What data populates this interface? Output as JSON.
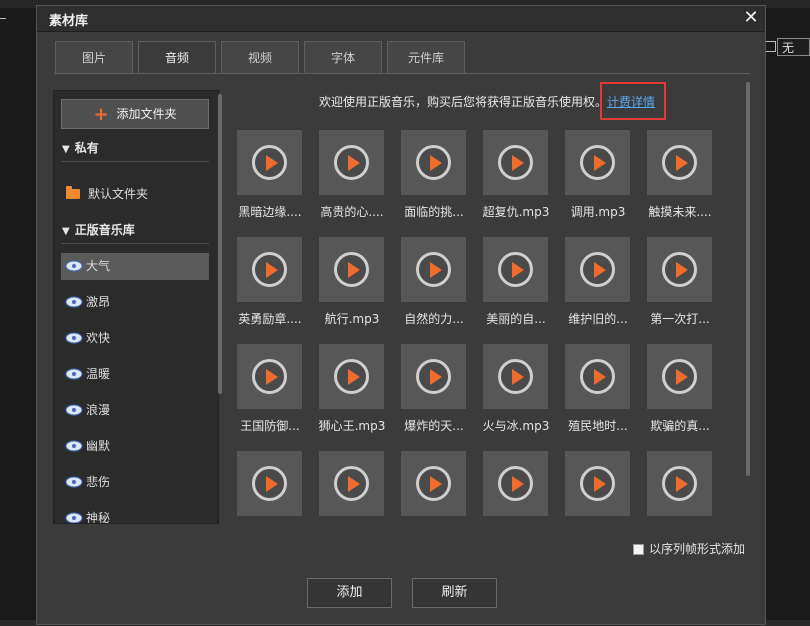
{
  "background": {
    "select_value": "无"
  },
  "dialog": {
    "title": "素材库",
    "close_glyph": "✕",
    "tabs": [
      {
        "label": "图片",
        "active": false
      },
      {
        "label": "音频",
        "active": true
      },
      {
        "label": "视频",
        "active": false
      },
      {
        "label": "字体",
        "active": false
      },
      {
        "label": "元件库",
        "active": false
      }
    ]
  },
  "sidebar": {
    "add_folder_label": "添加文件夹",
    "add_folder_icon": "plus-icon",
    "private_group": "私有",
    "default_folder": "默认文件夹",
    "library_group": "正版音乐库",
    "items": [
      {
        "label": "大气",
        "active": true
      },
      {
        "label": "激昂",
        "active": false
      },
      {
        "label": "欢快",
        "active": false
      },
      {
        "label": "温暖",
        "active": false
      },
      {
        "label": "浪漫",
        "active": false
      },
      {
        "label": "幽默",
        "active": false
      },
      {
        "label": "悲伤",
        "active": false
      },
      {
        "label": "神秘",
        "active": false
      }
    ]
  },
  "main": {
    "notice": "欢迎使用正版音乐，购买后您将获得正版音乐使用权。",
    "billing_link": "计费详情",
    "files": [
      "黑暗边缘....",
      "高贵的心....",
      "面临的挑...",
      "超复仇.mp3",
      "调用.mp3",
      "触摸未来....",
      "英勇励章....",
      "航行.mp3",
      "自然的力...",
      "美丽的自...",
      "维护旧的...",
      "第一次打...",
      "王国防御...",
      "狮心王.mp3",
      "爆炸的天...",
      "火与冰.mp3",
      "殖民地时...",
      "欺骗的真...",
      "",
      "",
      "",
      "",
      "",
      ""
    ]
  },
  "footer": {
    "sequence_label": "以序列帧形式添加",
    "sequence_checked": false,
    "add_label": "添加",
    "refresh_label": "刷新"
  },
  "colors": {
    "accent": "#ef6c2c",
    "link": "#5aa8f0",
    "highlight_box": "#e03a3a"
  }
}
